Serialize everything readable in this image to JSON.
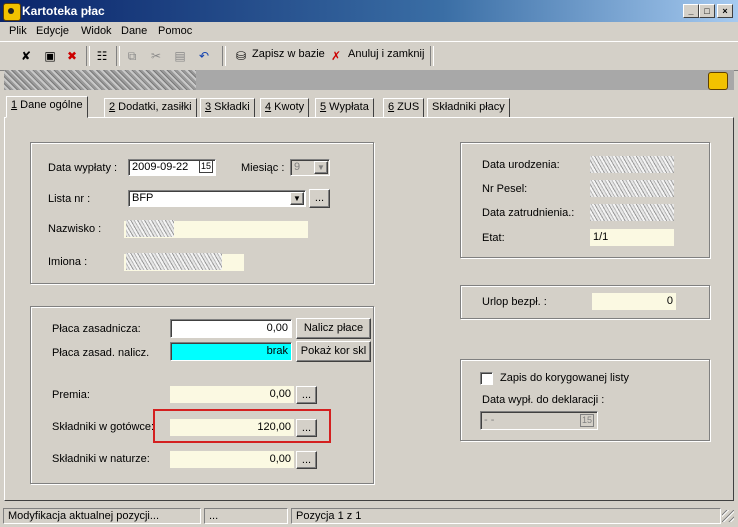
{
  "window": {
    "title": "Kartoteka płac"
  },
  "menu": {
    "items": [
      "Plik",
      "Edycje",
      "Widok",
      "Dane",
      "Pomoc"
    ]
  },
  "toolbar": {
    "save_label": "Zapisz w bazie",
    "cancel_label": "Anuluj i zamknij"
  },
  "tabs": [
    {
      "key": "1",
      "label": " Dane ogólne"
    },
    {
      "key": "2",
      "label": " Dodatki, zasiłki"
    },
    {
      "key": "3",
      "label": " Składki"
    },
    {
      "key": "4",
      "label": " Kwoty"
    },
    {
      "key": "5",
      "label": " Wypłata"
    },
    {
      "key": "6",
      "label": " ZUS"
    },
    {
      "key": "",
      "label": "Składniki płacy"
    }
  ],
  "form": {
    "data_wyplaty_label": "Data wypłaty :",
    "data_wyplaty_value": "2009-09-22",
    "miesiac_label": "Miesiąc :",
    "miesiac_value": "9",
    "lista_label": "Lista nr :",
    "lista_value": "BFP",
    "lista_more": "...",
    "nazwisko_label": "Nazwisko :",
    "imiona_label": "Imiona :"
  },
  "info": {
    "data_urodzenia_label": "Data urodzenia:",
    "pesel_label": "Nr Pesel:",
    "data_zatrudnienia_label": "Data zatrudnienia.:",
    "etat_label": "Etat:",
    "etat_value": "1/1"
  },
  "urlop": {
    "label": "Urlop bezpł. :",
    "value": "0"
  },
  "pay": {
    "placa_zasadnicza_label": "Płaca zasadnicza:",
    "placa_zasadnicza_value": "0,00",
    "nalicz_button": "Nalicz płace",
    "placa_zasad_nalicz_label": "Płaca zasad. nalicz.",
    "placa_zasad_nalicz_value": "brak",
    "pokaz_button": "Pokaż kor skl",
    "premia_label": "Premia:",
    "premia_value": "0,00",
    "gotowce_label": "Składniki w gotówce:",
    "gotowce_value": "120,00",
    "naturze_label": "Składniki w naturze:",
    "naturze_value": "0,00",
    "more": "..."
  },
  "korekta": {
    "zapis_label": "Zapis do korygowanej listy",
    "data_label": "Data wypł. do deklaracji :",
    "data_value": " -  - "
  },
  "status": {
    "left": "Modyfikacja aktualnej pozycji...",
    "middle": "...",
    "right": "Pozycja 1 z 1"
  },
  "colors": {
    "highlight_box": "#d42020",
    "cyan_field": "#00ffff",
    "readonly_field": "#fbf9e2"
  }
}
